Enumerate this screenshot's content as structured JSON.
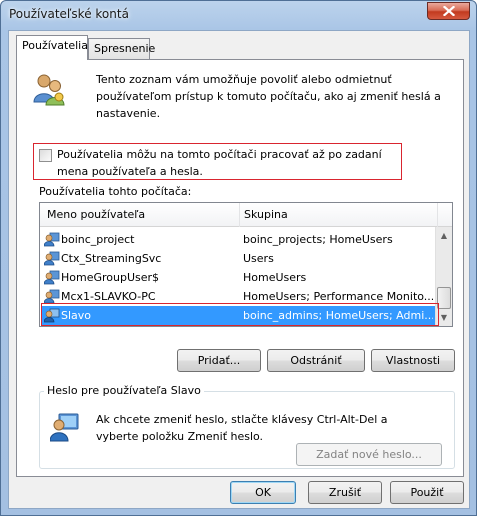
{
  "window": {
    "title": "Používateľské kontá",
    "close_glyph": "✕"
  },
  "tabs": [
    {
      "label": "Používatelia"
    },
    {
      "label": "Spresnenie"
    }
  ],
  "intro": {
    "text": "Tento zoznam vám umožňuje povoliť alebo odmietnuť používateľom prístup k tomuto počítaču, ako aj zmeniť heslá a nastavenie.",
    "icon": "users-icon"
  },
  "must_logon": {
    "label": "Používatelia môžu na tomto počítači pracovať až po zadaní mena používateľa a hesla.",
    "checked": false
  },
  "users_section": {
    "label": "Používatelia tohto počítača:",
    "columns": [
      "Meno používateľa",
      "Skupina"
    ],
    "rows": [
      {
        "name": "boinc_project",
        "group": "boinc_projects; HomeUsers",
        "selected": false
      },
      {
        "name": "Ctx_StreamingSvc",
        "group": "Users",
        "selected": false
      },
      {
        "name": "HomeGroupUser$",
        "group": "HomeUsers",
        "selected": false
      },
      {
        "name": "Mcx1-SLAVKO-PC",
        "group": "HomeUsers; Performance Monito...",
        "selected": false
      },
      {
        "name": "Slavo",
        "group": "boinc_admins; HomeUsers; Admi...",
        "selected": true
      }
    ]
  },
  "user_buttons": {
    "add": "Pridať...",
    "remove": "Odstrániť",
    "properties": "Vlastnosti"
  },
  "password_group": {
    "legend": "Heslo pre používateľa Slavo",
    "text": "Ak chcete zmeniť heslo, stlačte klávesy Ctrl-Alt-Del a vyberte položku Zmeniť heslo.",
    "button": "Zadať nové heslo..."
  },
  "footer": {
    "ok": "OK",
    "cancel": "Zrušiť",
    "apply": "Použiť"
  },
  "colors": {
    "selection": "#3399ff",
    "highlight_border": "#d9252f",
    "titlebar": "#a9c5e6"
  }
}
